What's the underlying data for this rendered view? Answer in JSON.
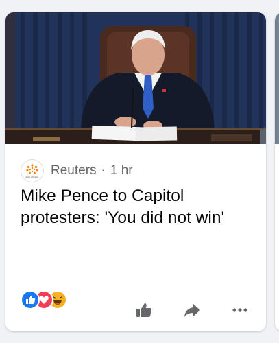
{
  "post": {
    "source_name": "Reuters",
    "separator": "·",
    "time": "1 hr",
    "logo_text": "REUTERS",
    "headline": "Mike Pence to Capitol protesters: 'You did not win'"
  },
  "reactions": [
    "like",
    "love",
    "haha"
  ],
  "icons": {
    "like": "thumbs-up-icon",
    "share": "share-arrow-icon",
    "more": "more-dots-icon"
  },
  "colors": {
    "like_blue": "#1877f2",
    "love_red": "#f33e58",
    "haha_yellow": "#f7b125",
    "action_gray": "#65676b",
    "reuters_orange": "#ff8000"
  }
}
